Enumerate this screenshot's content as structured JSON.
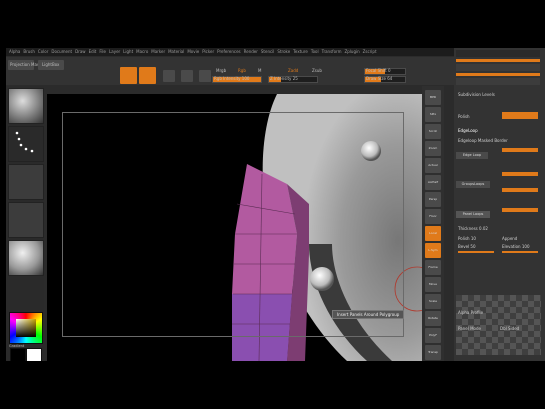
{
  "menu": [
    "Alpha",
    "Brush",
    "Color",
    "Document",
    "Draw",
    "Edit",
    "File",
    "Layer",
    "Light",
    "Macro",
    "Marker",
    "Material",
    "Movie",
    "Picker",
    "Preferences",
    "Render",
    "Stencil",
    "Stroke",
    "Texture",
    "Tool",
    "Transform",
    "Zplugin",
    "Zscript"
  ],
  "toolbar": {
    "projection_label": "Projection Master",
    "lightbox_label": "LightBox",
    "edit_label": "Edit",
    "draw_label": "Draw",
    "move_label": "Move",
    "scale_label": "Scale",
    "rotate_label": "Rotate",
    "mrgb_label": "Mrgb",
    "rgb_label": "Rgb",
    "m_label": "M",
    "zadd_label": "Zadd",
    "zsub_label": "Zsub",
    "rgb_intensity_label": "Rgb Intensity 100",
    "z_intensity_label": "Z Intensity 25",
    "focal_shift_label": "Focal Shift 0",
    "draw_size_label": "Draw Size 64",
    "colors": {
      "accent": "#e07a1a"
    }
  },
  "viewport": {
    "tooltip": "Insert Panels Around Polygroup"
  },
  "right_tools": [
    "BPR",
    "SPix",
    "Scroll",
    "Zoom",
    "Actual",
    "AAHalf",
    "Persp",
    "Floor",
    "Local",
    "L.Sym",
    "Frame",
    "Move",
    "Scale",
    "Rotate",
    "PolyF",
    "Transp"
  ],
  "tray": {
    "title": "Panel Loops",
    "subtitle": "Subdivision Levels",
    "polish_label": "Polish",
    "edgeloop_label": "EdgeLoop",
    "edgeloop_masked_label": "Edgeloop Masked Border",
    "edge_loop_label": "Edge Loop",
    "groups_loops_label": "GroupsLoops",
    "panel_loops_label": "Panel Loops",
    "thickness_label": "Thickness 0.02",
    "append_label": "Append",
    "polish_value_label": "Polish 10",
    "bevel_label": "Bevel 50",
    "elevation_label": "Elevation 100",
    "alpha_label": "Alpha Profile",
    "panel_mode_label": "Panel Mode",
    "dblsided_label": "Dbl Sided"
  },
  "left": {
    "swatch_label": "SwitchColor",
    "gradient_label": "Gradient"
  }
}
